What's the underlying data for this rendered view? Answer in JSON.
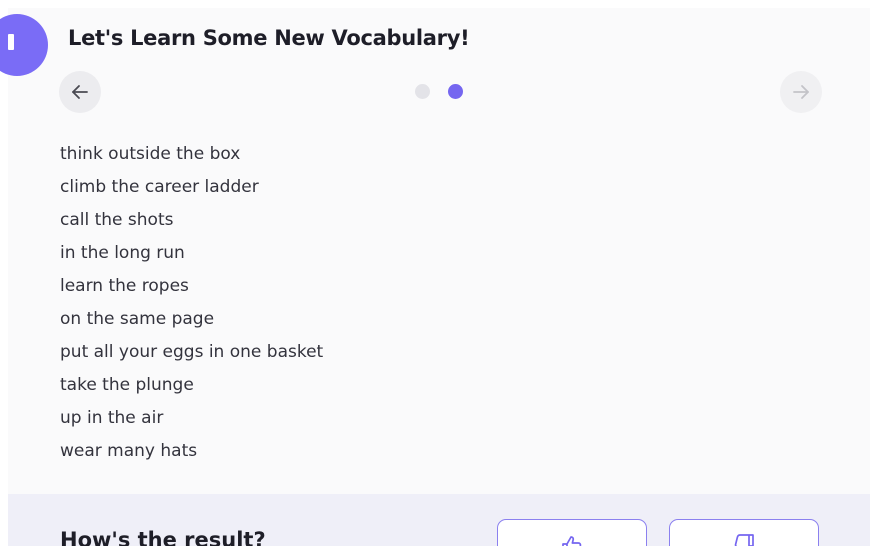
{
  "header": {
    "title": "Let's Learn Some New Vocabulary!"
  },
  "carousel": {
    "prev_icon": "arrow-left-icon",
    "next_icon": "arrow-right-icon",
    "pages": 2,
    "active_page": 2
  },
  "vocabulary": {
    "items": [
      "think outside the box",
      "climb the career ladder",
      "call the shots",
      "in the long run",
      "learn the ropes",
      "on the same page",
      "put all your eggs in one basket",
      "take the plunge",
      "up in the air",
      "wear many hats"
    ]
  },
  "feedback": {
    "title": "How's the result?",
    "like_icon": "thumbs-up-icon",
    "dislike_icon": "thumbs-down-icon"
  },
  "colors": {
    "accent": "#7566f0",
    "avatar": "#7a6cf6",
    "feedback_bg": "#efeff8"
  }
}
